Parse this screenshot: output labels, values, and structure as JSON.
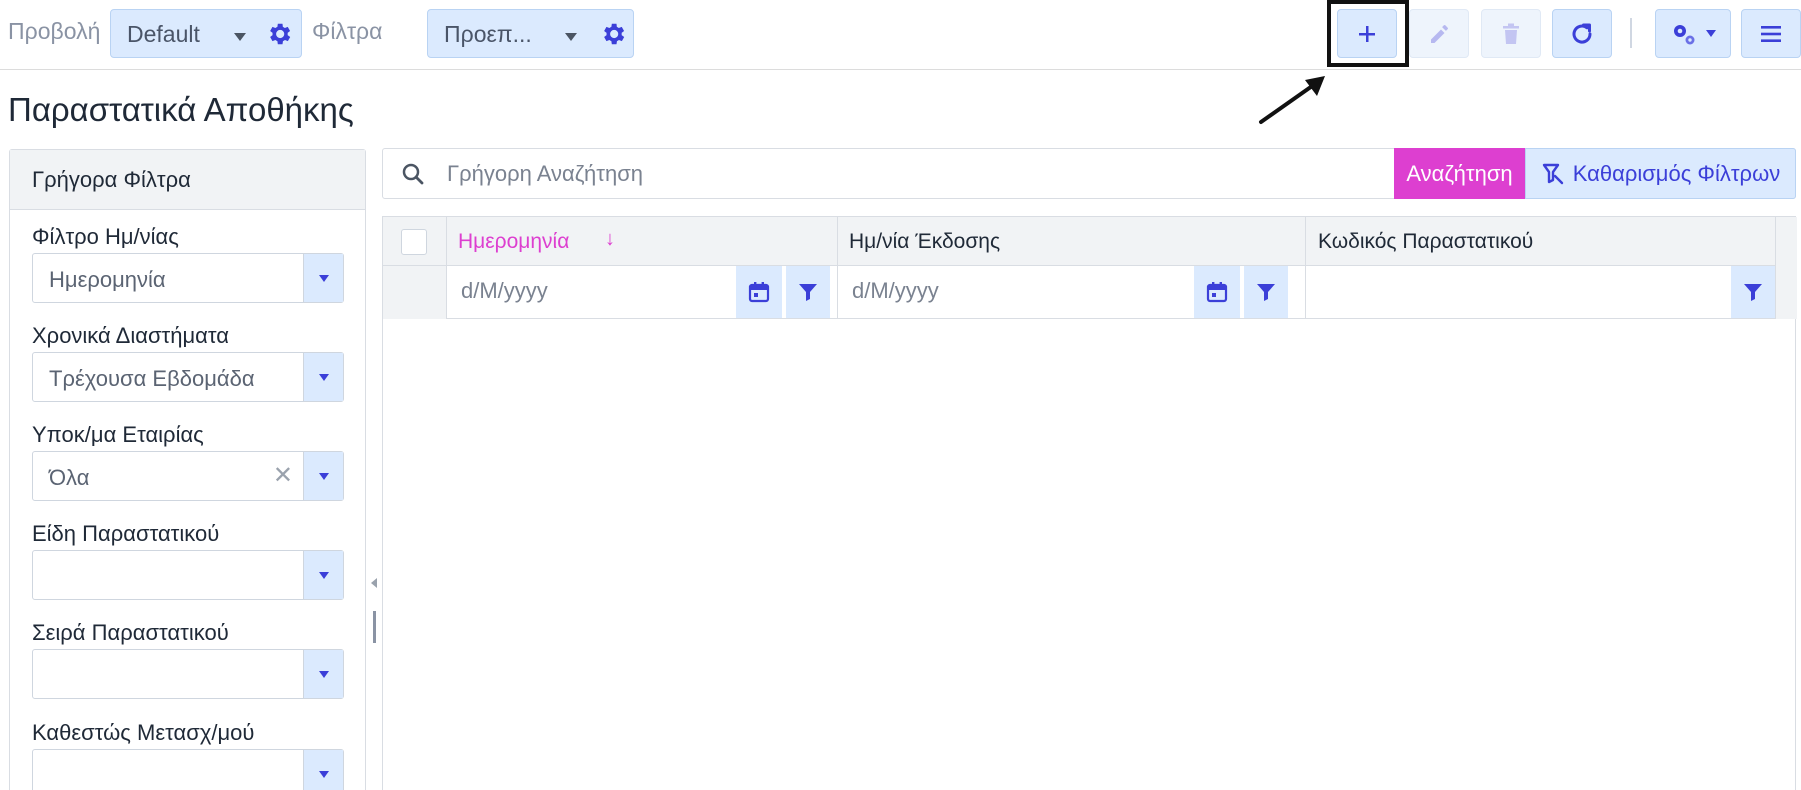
{
  "toolbar": {
    "view_label": "Προβολή",
    "view_value": "Default",
    "filters_label": "Φίλτρα",
    "filters_value": "Προεπ..."
  },
  "page": {
    "title": "Παραστατικά Αποθήκης"
  },
  "quick_filters": {
    "title": "Γρήγορα Φίλτρα",
    "fields": [
      {
        "label": "Φίλτρο Ημ/νίας",
        "value": "Ημερομηνία"
      },
      {
        "label": "Χρονικά Διαστήματα",
        "value": "Τρέχουσα Εβδομάδα"
      },
      {
        "label": "Υποκ/μα Εταιρίας",
        "value": "Όλα",
        "clear": "✕"
      },
      {
        "label": "Είδη Παραστατικού",
        "value": ""
      },
      {
        "label": "Σειρά Παραστατικού",
        "value": ""
      },
      {
        "label": "Καθεστώς Μετασχ/μού",
        "value": ""
      }
    ]
  },
  "search": {
    "placeholder": "Γρήγορη Αναζήτηση",
    "search_button": "Αναζήτηση",
    "clear_filters_button": "Καθαρισμός Φίλτρων"
  },
  "grid": {
    "columns": [
      {
        "header": "Ημερομηνία",
        "sort": "↓",
        "filter_placeholder": "d/M/yyyy"
      },
      {
        "header": "Ημ/νία Έκδοσης",
        "filter_placeholder": "d/M/yyyy"
      },
      {
        "header": "Κωδικός Παραστατικού",
        "filter_placeholder": ""
      }
    ]
  },
  "icons": {
    "add": "plus-icon",
    "edit": "pencil-icon",
    "delete": "trash-icon",
    "refresh": "refresh-icon",
    "settings": "gears-icon",
    "menu": "hamburger-icon"
  },
  "colors": {
    "accent": "#3b3fd8",
    "button_bg": "#dbeafe",
    "search_button": "#dd3fd0",
    "sorted_header": "#dd3fd0"
  }
}
